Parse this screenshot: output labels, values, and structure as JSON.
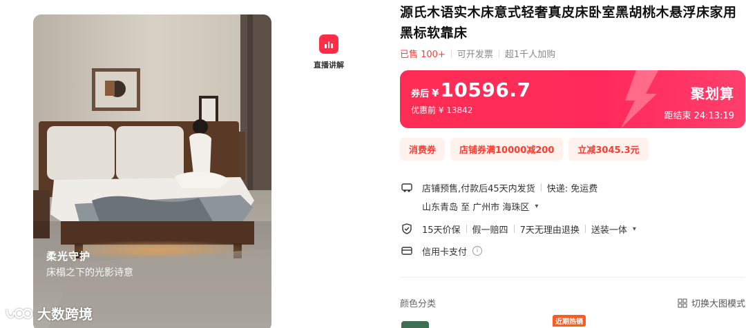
{
  "product": {
    "title": "源氏木语实木床意式轻奢真皮床卧室黑胡桃木悬浮床家用黑标软靠床",
    "sold": "已售 100+",
    "invoice": "可开发票",
    "cart": "超1千人加购"
  },
  "hero": {
    "caption_title": "柔光守护",
    "caption_sub": "床榻之下的光影诗意"
  },
  "watermark": {
    "text": "大数跨境"
  },
  "live": {
    "label": "直播讲解",
    "icon": "live-bars-icon"
  },
  "price": {
    "tag": "券后",
    "currency": "¥",
    "amount": "10596.7",
    "original": "优惠前 ¥ 13842",
    "campaign": "聚划算",
    "countdown": "距结束 24:13:19",
    "colors": {
      "start": "#ff2d55",
      "end": "#ff3f6c"
    }
  },
  "coupons": [
    "消费券",
    "店铺券满10000减200",
    "立减3045.3元"
  ],
  "shipping": {
    "presale": "店铺预售,付款后45天内发货",
    "express": "快递: 免运费",
    "route": "山东青岛 至 广州市 海珠区"
  },
  "guarantee": {
    "items": [
      "15天价保",
      "假一赔四",
      "7天无理由退换",
      "送装一体"
    ]
  },
  "payment": {
    "label": "信用卡支付"
  },
  "variants": {
    "label": "颜色分类",
    "switch_label": "切换大图模式",
    "hot_badge": "近期热销"
  }
}
